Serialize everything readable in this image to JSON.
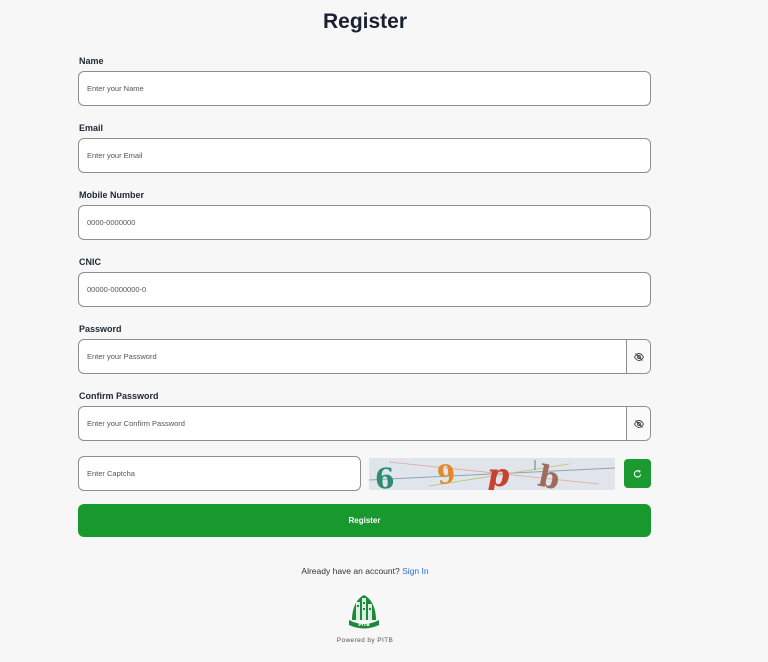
{
  "page": {
    "title": "Register"
  },
  "fields": {
    "name": {
      "label": "Name",
      "placeholder": "Enter your Name"
    },
    "email": {
      "label": "Email",
      "placeholder": "Enter your Email"
    },
    "mobile": {
      "label": "Mobile Number",
      "placeholder": "0000-0000000"
    },
    "cnic": {
      "label": "CNIC",
      "placeholder": "00000-0000000-0"
    },
    "password": {
      "label": "Password",
      "placeholder": "Enter your Password",
      "toggle_icon": "eye-slash-icon"
    },
    "confirm_password": {
      "label": "Confirm Password",
      "placeholder": "Enter your Confirm Password",
      "toggle_icon": "eye-slash-icon"
    },
    "captcha": {
      "placeholder": "Enter Captcha",
      "image_text": "69pb",
      "refresh_icon": "refresh-icon"
    }
  },
  "actions": {
    "register_label": "Register",
    "signin_prompt": "Already have an account?",
    "signin_link": "Sign In"
  },
  "footer": {
    "logo_text": "PITB",
    "powered_by": "Powered by PITB"
  },
  "colors": {
    "primary_green": "#18992e",
    "link_blue": "#2b6fd6",
    "background": "#f7f7f7"
  }
}
